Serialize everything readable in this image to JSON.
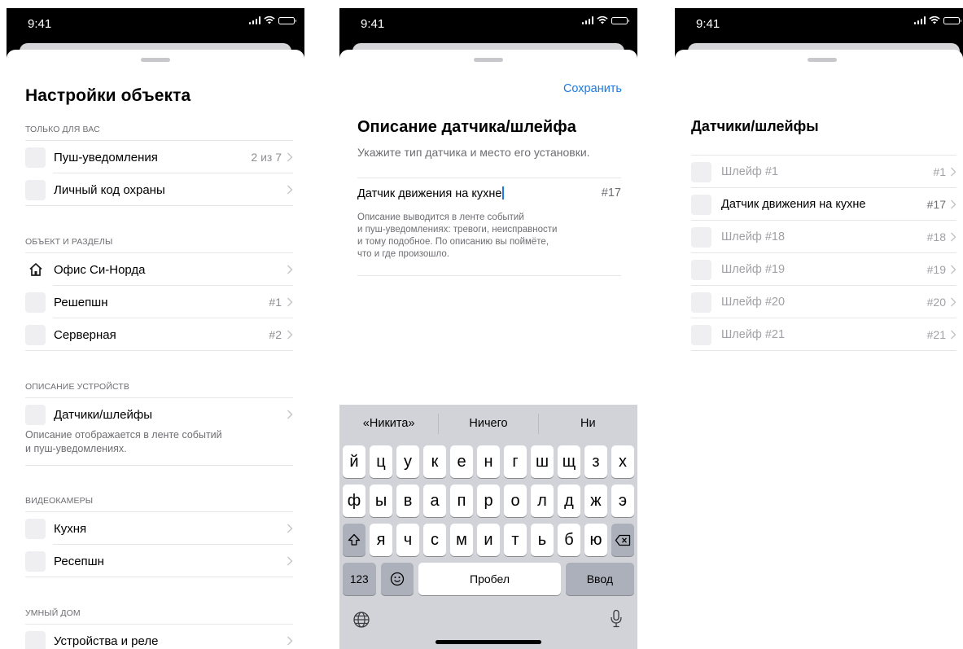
{
  "status": {
    "time": "9:41"
  },
  "settings": {
    "title": "Настройки объекта",
    "sections": [
      {
        "header": "ТОЛЬКО ДЛЯ ВАС",
        "rows": [
          {
            "label": "Пуш-уведомления",
            "value": "2 из 7"
          },
          {
            "label": "Личный код охраны",
            "value": ""
          }
        ]
      },
      {
        "header": "ОБЪЕКТ И РАЗДЕЛЫ",
        "rows": [
          {
            "label": "Офис Си-Норда",
            "value": "",
            "icon": "home-icon"
          },
          {
            "label": "Решепшн",
            "value": "#1"
          },
          {
            "label": "Серверная",
            "value": "#2"
          }
        ]
      },
      {
        "header": "ОПИСАНИЕ УСТРОЙСТВ",
        "rows": [
          {
            "label": "Датчики/шлейфы",
            "value": ""
          }
        ],
        "footer_line1": "Описание отображается в ленте событий",
        "footer_line2": "и пуш-уведомлениях."
      },
      {
        "header": "ВИДЕОКАМЕРЫ",
        "rows": [
          {
            "label": "Кухня",
            "value": ""
          },
          {
            "label": "Ресепшн",
            "value": ""
          }
        ]
      },
      {
        "header": "УМНЫЙ ДОМ",
        "rows": [
          {
            "label": "Устройства и реле",
            "value": ""
          }
        ]
      }
    ]
  },
  "description": {
    "save_label": "Сохранить",
    "title": "Описание датчика/шлейфа",
    "subtitle": "Укажите тип датчика и место его установки.",
    "field_value": "Датчик движения на кухне",
    "field_number": "#17",
    "hint_lines": [
      "Описание выводится в ленте событий",
      "и пуш-уведомлениях: тревоги, неисправности",
      "и тому подобное. По описанию вы поймёте,",
      "что и где произошло."
    ]
  },
  "keyboard": {
    "suggestions": [
      "«Никита»",
      "Ничего",
      "Ни"
    ],
    "row1": [
      "й",
      "ц",
      "у",
      "к",
      "е",
      "н",
      "г",
      "ш",
      "щ",
      "з",
      "х"
    ],
    "row2": [
      "ф",
      "ы",
      "в",
      "а",
      "п",
      "р",
      "о",
      "л",
      "д",
      "ж",
      "э"
    ],
    "row3": [
      "я",
      "ч",
      "с",
      "м",
      "и",
      "т",
      "ь",
      "б",
      "ю"
    ],
    "numbers_label": "123",
    "space_label": "Пробел",
    "enter_label": "Ввод"
  },
  "sensors": {
    "title": "Датчики/шлейфы",
    "rows": [
      {
        "label": "Шлейф #1",
        "value": "#1",
        "dim": true
      },
      {
        "label": "Датчик движения на кухне",
        "value": "#17",
        "dim": false
      },
      {
        "label": "Шлейф #18",
        "value": "#18",
        "dim": true
      },
      {
        "label": "Шлейф #19",
        "value": "#19",
        "dim": true
      },
      {
        "label": "Шлейф #20",
        "value": "#20",
        "dim": true
      },
      {
        "label": "Шлейф #21",
        "value": "#21",
        "dim": true
      }
    ]
  },
  "colors": {
    "accent": "#1a7ce0",
    "secondary_text": "#6d6d72",
    "dim_text": "#a1a1a6"
  }
}
